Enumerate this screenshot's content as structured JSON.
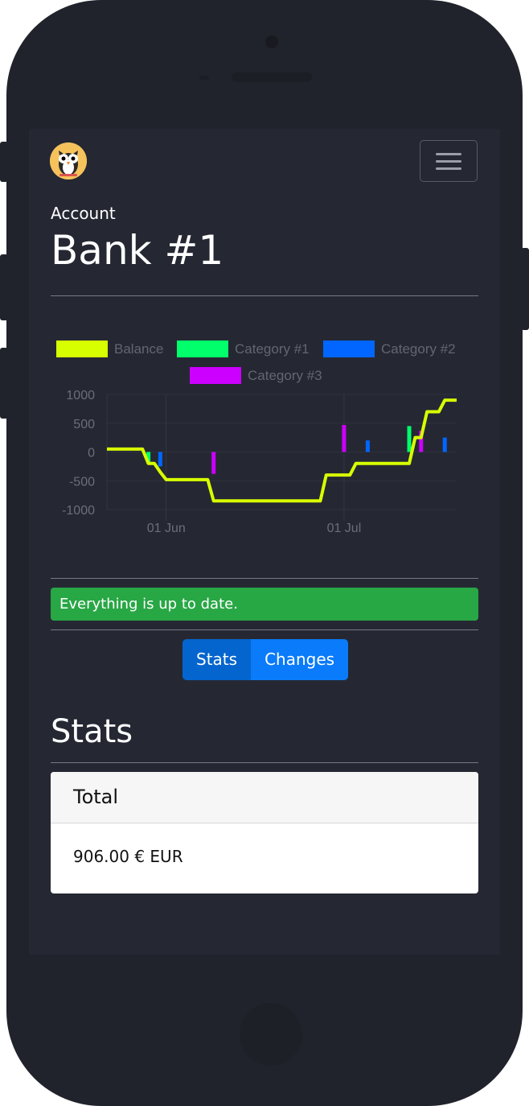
{
  "header": {
    "eyebrow": "Account",
    "title": "Bank #1"
  },
  "chart_data": {
    "type": "line",
    "legend": [
      {
        "name": "Balance",
        "color": "#d8ff00"
      },
      {
        "name": "Category #1",
        "color": "#00ff6a"
      },
      {
        "name": "Category #2",
        "color": "#0066ff"
      },
      {
        "name": "Category #3",
        "color": "#cc00ff"
      }
    ],
    "y_ticks": [
      "1000",
      "500",
      "0",
      "-500",
      "-1000"
    ],
    "ylim": [
      -1000,
      1000
    ],
    "x_ticks": [
      {
        "label": "01 Jun",
        "day": 0
      },
      {
        "label": "01 Jul",
        "day": 30
      }
    ],
    "xlim": [
      -10,
      49
    ],
    "series": [
      {
        "name": "Balance",
        "type": "step-line",
        "x": [
          -10,
          -4,
          -3,
          -2,
          -1,
          0,
          1,
          2,
          7,
          8,
          9,
          10,
          11,
          12,
          13,
          14,
          15,
          16,
          17,
          18,
          19,
          20,
          21,
          22,
          23,
          24,
          25,
          26,
          27,
          28,
          29,
          30,
          31,
          32,
          33,
          34,
          35,
          36,
          37,
          38,
          39,
          40,
          41,
          42,
          43,
          44,
          45,
          46,
          47,
          48,
          49
        ],
        "y": [
          50,
          50,
          -200,
          -200,
          -350,
          -480,
          -480,
          -480,
          -480,
          -850,
          -850,
          -850,
          -850,
          -850,
          -850,
          -850,
          -850,
          -850,
          -850,
          -850,
          -850,
          -850,
          -850,
          -850,
          -850,
          -850,
          -850,
          -850,
          -400,
          -400,
          -400,
          -400,
          -400,
          -200,
          -200,
          -200,
          -200,
          -200,
          -200,
          -200,
          -200,
          -200,
          -200,
          250,
          250,
          700,
          700,
          700,
          900,
          900,
          900
        ]
      },
      {
        "name": "Category #1",
        "type": "bar",
        "x": [
          -3,
          41
        ],
        "y": [
          -200,
          450
        ]
      },
      {
        "name": "Category #2",
        "type": "bar",
        "x": [
          -1,
          34,
          47
        ],
        "y": [
          -250,
          200,
          250
        ]
      },
      {
        "name": "Category #3",
        "type": "bar",
        "x": [
          8,
          30,
          43
        ],
        "y": [
          -380,
          470,
          370
        ]
      }
    ]
  },
  "status": {
    "message": "Everything is up to date."
  },
  "tabs": {
    "stats": "Stats",
    "changes": "Changes"
  },
  "stats": {
    "title": "Stats",
    "card_header": "Total",
    "total_value": "906.00 € EUR"
  }
}
